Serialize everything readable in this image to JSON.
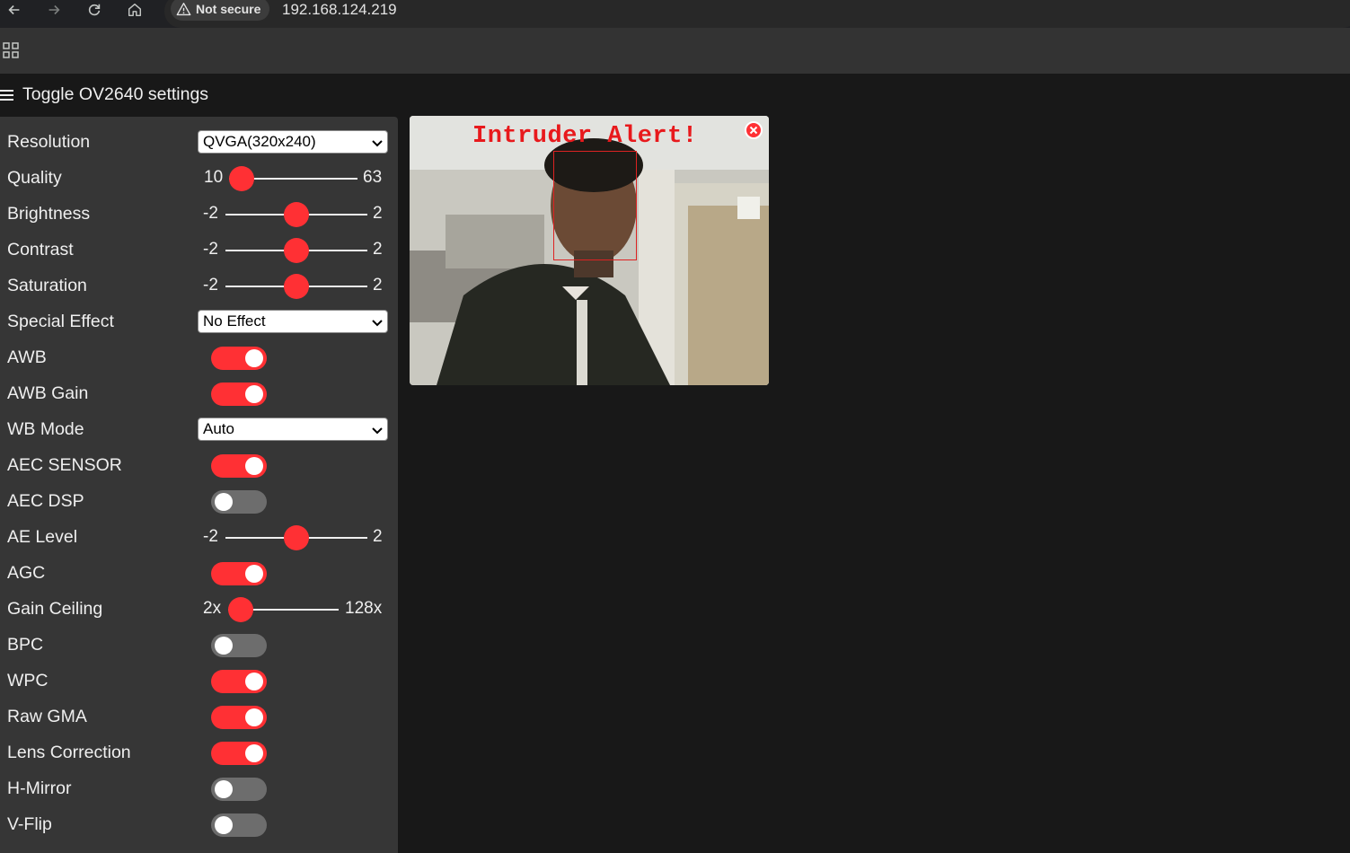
{
  "browser": {
    "security_label": "Not secure",
    "url": "192.168.124.219"
  },
  "page": {
    "menu_toggle_label": "Toggle OV2640 settings",
    "stream_overlay_text": "Intruder Alert!"
  },
  "settings": {
    "resolution": {
      "label": "Resolution",
      "value": "QVGA(320x240)"
    },
    "quality": {
      "label": "Quality",
      "min": "10",
      "max": "63",
      "value": 10
    },
    "brightness": {
      "label": "Brightness",
      "min": "-2",
      "max": "2",
      "value": 0
    },
    "contrast": {
      "label": "Contrast",
      "min": "-2",
      "max": "2",
      "value": 0
    },
    "saturation": {
      "label": "Saturation",
      "min": "-2",
      "max": "2",
      "value": 0
    },
    "special_effect": {
      "label": "Special Effect",
      "value": "No Effect"
    },
    "awb": {
      "label": "AWB",
      "on": true
    },
    "awb_gain": {
      "label": "AWB Gain",
      "on": true
    },
    "wb_mode": {
      "label": "WB Mode",
      "value": "Auto"
    },
    "aec_sensor": {
      "label": "AEC SENSOR",
      "on": true
    },
    "aec_dsp": {
      "label": "AEC DSP",
      "on": false
    },
    "ae_level": {
      "label": "AE Level",
      "min": "-2",
      "max": "2",
      "value": 0
    },
    "agc": {
      "label": "AGC",
      "on": true
    },
    "gain_ceiling": {
      "label": "Gain Ceiling",
      "min": "2x",
      "max": "128x",
      "value": "2x"
    },
    "bpc": {
      "label": "BPC",
      "on": false
    },
    "wpc": {
      "label": "WPC",
      "on": true
    },
    "raw_gma": {
      "label": "Raw GMA",
      "on": true
    },
    "lens_correction": {
      "label": "Lens Correction",
      "on": true
    },
    "h_mirror": {
      "label": "H-Mirror",
      "on": false
    },
    "v_flip": {
      "label": "V-Flip",
      "on": false
    }
  },
  "icons": {
    "back": "arrow-left-icon",
    "forward": "arrow-right-icon",
    "reload": "reload-icon",
    "home": "home-icon",
    "warning": "warning-icon",
    "apps": "apps-grid-icon",
    "menu": "hamburger-icon",
    "close": "close-icon",
    "dropdown": "chevron-down-icon"
  },
  "colors": {
    "accent": "#ff3034",
    "panel": "#363636",
    "background": "#181818"
  }
}
